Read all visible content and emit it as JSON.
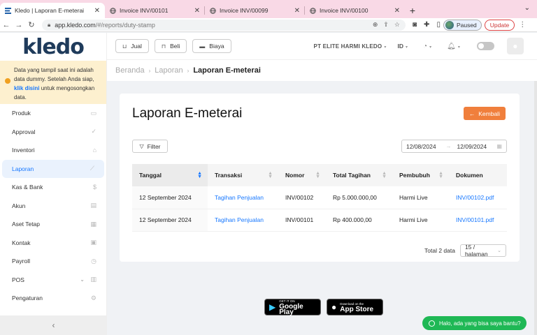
{
  "browser": {
    "tabs": [
      {
        "title": "Kledo | Laporan E-meterai",
        "active": true
      },
      {
        "title": "Invoice INV/00101",
        "active": false
      },
      {
        "title": "Invoice INV/00099",
        "active": false
      },
      {
        "title": "Invoice INV/00100",
        "active": false
      }
    ],
    "url_host": "app.kledo.com",
    "url_path": "/#/reports/duty-stamp",
    "profile_label": "Paused",
    "update_label": "Update"
  },
  "sidebar": {
    "logo": "kledo",
    "notice": {
      "text_before": "Data yang tampil saat ini adalah data dummy. Setelah Anda siap, ",
      "link": "klik disini",
      "text_after": " untuk mengosongkan data."
    },
    "items": [
      {
        "label": "Produk",
        "icon": "box-icon"
      },
      {
        "label": "Approval",
        "icon": "check-icon"
      },
      {
        "label": "Inventori",
        "icon": "warehouse-icon"
      },
      {
        "label": "Laporan",
        "icon": "chart-icon",
        "active": true
      },
      {
        "label": "Kas & Bank",
        "icon": "dollar-icon"
      },
      {
        "label": "Akun",
        "icon": "ledger-icon"
      },
      {
        "label": "Aset Tetap",
        "icon": "building-icon"
      },
      {
        "label": "Kontak",
        "icon": "contact-card-icon"
      },
      {
        "label": "Payroll",
        "icon": "payroll-icon"
      },
      {
        "label": "POS",
        "icon": "pos-icon"
      },
      {
        "label": "Pengaturan",
        "icon": "gear-icon"
      }
    ]
  },
  "topbar": {
    "buttons": [
      {
        "label": "Jual",
        "icon": "basket-icon"
      },
      {
        "label": "Beli",
        "icon": "bag-icon"
      },
      {
        "label": "Biaya",
        "icon": "card-icon"
      }
    ],
    "company": "PT ELITE HARMI KLEDO",
    "language": "ID"
  },
  "breadcrumb": {
    "items": [
      "Beranda",
      "Laporan"
    ],
    "current": "Laporan E-meterai"
  },
  "page": {
    "title": "Laporan E-meterai",
    "back_label": "Kembali",
    "filter_label": "Filter",
    "date_start": "12/08/2024",
    "date_end": "12/09/2024"
  },
  "table": {
    "columns": [
      "Tanggal",
      "Transaksi",
      "Nomor",
      "Total Tagihan",
      "Pembubuh",
      "Dokumen"
    ],
    "rows": [
      {
        "tanggal": "12 September 2024",
        "transaksi": "Tagihan Penjualan",
        "nomor": "INV/00102",
        "total": "Rp 5.000.000,00",
        "pembubuh": "Harmi Live",
        "dokumen": "INV/00102.pdf"
      },
      {
        "tanggal": "12 September 2024",
        "transaksi": "Tagihan Penjualan",
        "nomor": "INV/00101",
        "total": "Rp 400.000,00",
        "pembubuh": "Harmi Live",
        "dokumen": "INV/00101.pdf"
      }
    ],
    "total_label": "Total 2 data",
    "page_size": "15 / halaman"
  },
  "footer": {
    "google_play_small": "GET IT ON",
    "google_play_big": "Google Play",
    "app_store_small": "Download on the",
    "app_store_big": "App Store",
    "whatsapp_label": "Halo, ada yang bisa saya bantu?"
  },
  "colors": {
    "accent": "#1677ff",
    "back_button": "#f07f3c",
    "whatsapp": "#1fb855",
    "notice_bg": "#fdf0cf"
  }
}
